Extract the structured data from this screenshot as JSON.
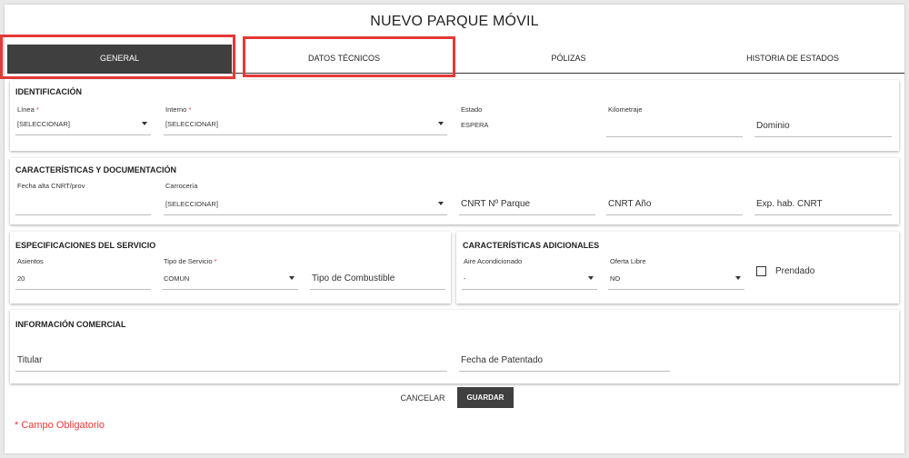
{
  "dialog": {
    "title": "NUEVO PARQUE MÓVIL"
  },
  "tabs": [
    {
      "label": "GENERAL",
      "active": true
    },
    {
      "label": "DATOS TÉCNICOS",
      "active": false
    },
    {
      "label": "PÓLIZAS",
      "active": false
    },
    {
      "label": "HISTORIA DE ESTADOS",
      "active": false
    }
  ],
  "sections": {
    "identificacion": {
      "title": "IDENTIFICACIÓN",
      "linea": {
        "label": "Línea",
        "value": "[SELECCIONAR]"
      },
      "interno": {
        "label": "Interno",
        "value": "[SELECCIONAR]"
      },
      "estado": {
        "label": "Estado",
        "value": "ESPERA"
      },
      "kilometraje": {
        "label": "Kilometraje",
        "value": ""
      },
      "dominio": {
        "placeholder": "Dominio"
      }
    },
    "caracteristicas": {
      "title": "CARACTERÍSTICAS Y DOCUMENTACIÓN",
      "fecha_alta": {
        "label": "Fecha alta CNRT/prov",
        "value": ""
      },
      "carroceria": {
        "label": "Carrocería",
        "value": "[SELECCIONAR]"
      },
      "cnrt_parque": {
        "placeholder": "CNRT Nº Parque"
      },
      "cnrt_anio": {
        "placeholder": "CNRT Año"
      },
      "exp_hab": {
        "placeholder": "Exp. hab. CNRT"
      }
    },
    "especificaciones": {
      "title": "ESPECIFICACIONES DEL SERVICIO",
      "asientos": {
        "label": "Asientos",
        "value": "20"
      },
      "tipo_servicio": {
        "label": "Tipo de Servicio",
        "value": "COMUN"
      },
      "tipo_combustible": {
        "placeholder": "Tipo de Combustible"
      }
    },
    "adicionales": {
      "title": "CARACTERÍSTICAS ADICIONALES",
      "aire": {
        "label": "Aire Acondicionado",
        "value": "-"
      },
      "oferta_libre": {
        "label": "Oferta Libre",
        "value": "NO"
      },
      "prendado": {
        "label": "Prendado",
        "checked": false
      }
    },
    "comercial": {
      "title": "INFORMACIÓN COMERCIAL",
      "titular": {
        "placeholder": "Titular"
      },
      "fecha_patentado": {
        "placeholder": "Fecha de Patentado"
      }
    }
  },
  "actions": {
    "cancel": "CANCELAR",
    "save": "GUARDAR"
  },
  "required_asterisk": "*",
  "required_note": "* Campo Obligatorio",
  "colors": {
    "accent_dark": "#3f3f3f",
    "required_red": "#e53935",
    "highlight_red": "#e53935"
  }
}
